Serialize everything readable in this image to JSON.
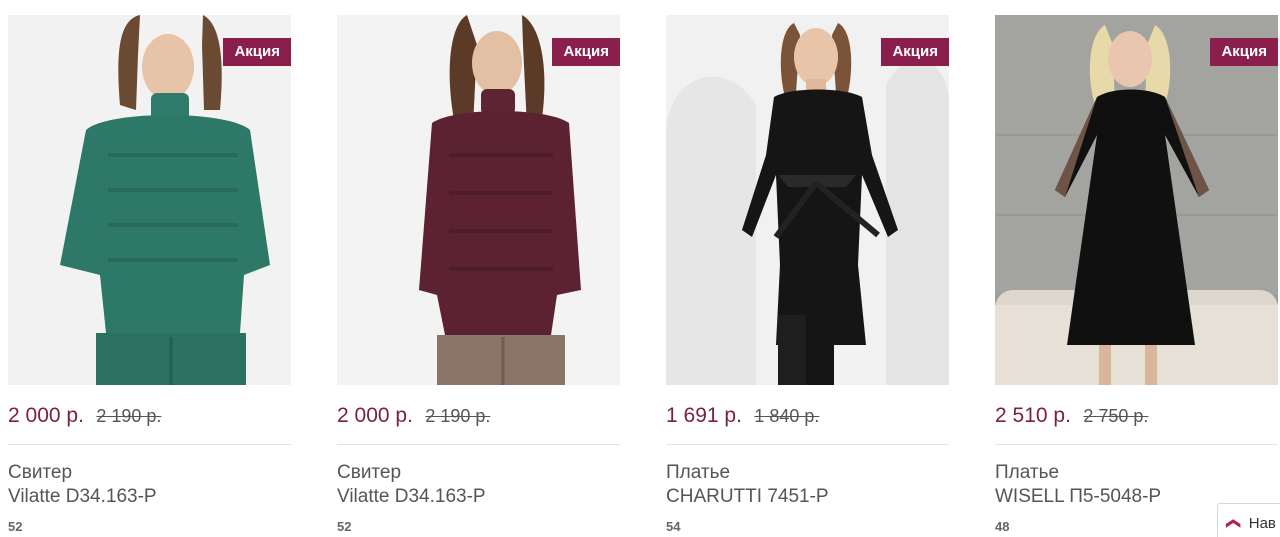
{
  "products": [
    {
      "badge": "Акция",
      "price": "2 000 р.",
      "old_price": "2 190 р.",
      "type": "Свитер",
      "name": "Vilatte D34.163-P",
      "size": "52"
    },
    {
      "badge": "Акция",
      "price": "2 000 р.",
      "old_price": "2 190 р.",
      "type": "Свитер",
      "name": "Vilatte D34.163-P",
      "size": "52"
    },
    {
      "badge": "Акция",
      "price": "1 691 р.",
      "old_price": "1 840 р.",
      "type": "Платье",
      "name": "CHARUTTI 7451-P",
      "size": "54"
    },
    {
      "badge": "Акция",
      "price": "2 510 р.",
      "old_price": "2 750 р.",
      "type": "Платье",
      "name": "WISELL П5-5048-P",
      "size": "48"
    }
  ],
  "nav_button": {
    "label": "Нав"
  },
  "colors": {
    "badge": "#8a1f4e",
    "price": "#7a1f45",
    "nav_chevron": "#b0234f"
  }
}
